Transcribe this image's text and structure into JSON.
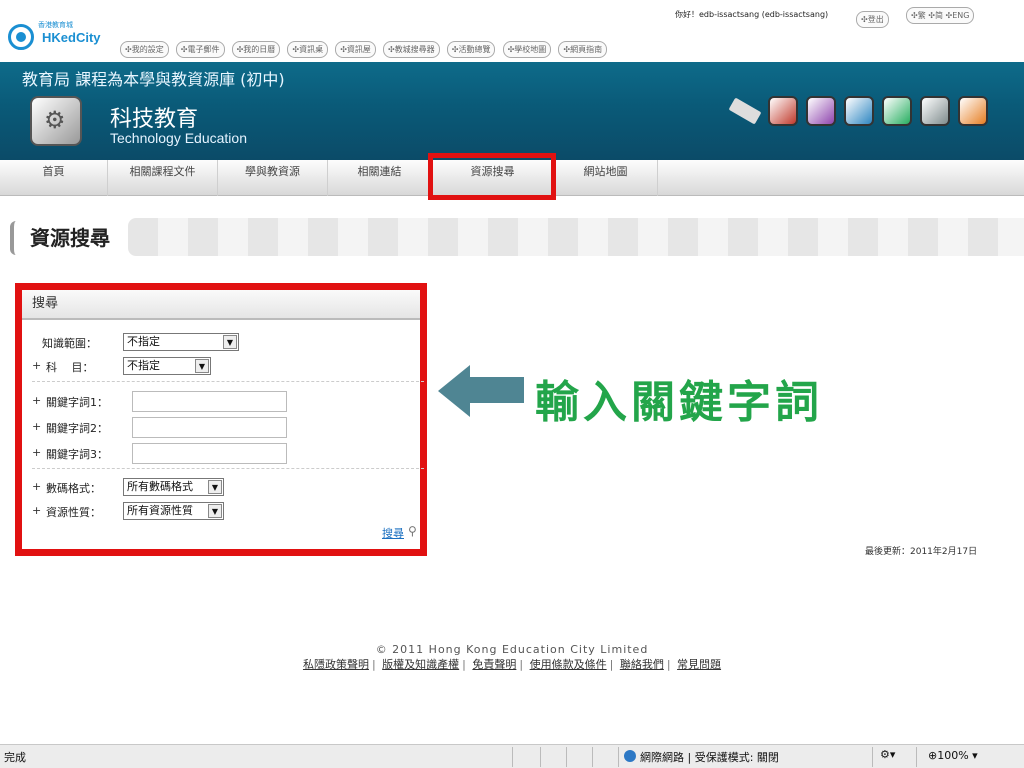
{
  "topbar": {
    "logo_small": "香港教育城",
    "logo_brand": "HKedCity",
    "greeting": "你好！edb-issactsang (edb-issactsang)",
    "auth_pills": [
      "登出"
    ],
    "lang_pills": [
      "繁",
      "简",
      "ENG"
    ],
    "nav_pills": [
      "我的設定",
      "電子郵件",
      "我的日曆",
      "資訊桌",
      "資訊屋",
      "教城搜尋器",
      "活動總覽",
      "學校地圖",
      "網頁指南"
    ]
  },
  "header": {
    "edb_title": "教育局 課程為本學與教資源庫 (初中)",
    "subject_zh": "科技教育",
    "subject_en": "Technology Education",
    "icon_colors": [
      "#c0392b",
      "#8e44ad",
      "#2e86c1",
      "#27ae60",
      "#7f8c8d",
      "#e67e22"
    ]
  },
  "nav": {
    "items": [
      "首頁",
      "相關課程文件",
      "學與教資源",
      "相關連結",
      "資源搜尋",
      "網站地圖"
    ],
    "active": "資源搜尋"
  },
  "section": {
    "title": "資源搜尋"
  },
  "search_panel": {
    "header": "搜尋",
    "knowledge_label": "知識範圍：",
    "knowledge_value": "不指定",
    "subject_label": "科　 目：",
    "subject_value": "不指定",
    "keyword1_label": "關鍵字詞1：",
    "keyword2_label": "關鍵字詞2：",
    "keyword3_label": "關鍵字詞3：",
    "keyword1_value": "",
    "keyword2_value": "",
    "keyword3_value": "",
    "format_label": "數碼格式：",
    "format_value": "所有數碼格式",
    "nature_label": "資源性質：",
    "nature_value": "所有資源性質",
    "search_link": "搜尋",
    "plus": "+"
  },
  "annotation": {
    "text": "輸入關鍵字詞",
    "highlight_color": "#e11111",
    "arrow_color": "#4f8593",
    "text_color": "#23a54a"
  },
  "updated": "最後更新：2011年2月17日",
  "footer": {
    "copyright": "© 2011 Hong Kong Education City Limited",
    "links": [
      "私隱政策聲明",
      "版權及知識產權",
      "免責聲明",
      "使用條款及條件",
      "聯絡我們",
      "常見問題"
    ]
  },
  "statusbar": {
    "left": "完成",
    "zone": "網際網路 | 受保護模式: 關閉",
    "zoom": "100%"
  }
}
